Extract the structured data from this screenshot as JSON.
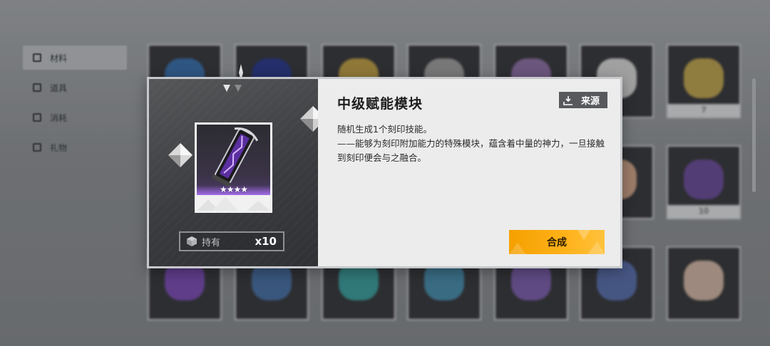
{
  "sidebar": {
    "items": [
      {
        "label": "材料",
        "icon": "material-icon",
        "active": true
      },
      {
        "label": "道具",
        "icon": "prop-icon",
        "active": false
      },
      {
        "label": "消耗",
        "icon": "consumable-icon",
        "active": false
      },
      {
        "label": "礼物",
        "icon": "gift-icon",
        "active": false
      }
    ]
  },
  "grid_counts": [
    "",
    "",
    "",
    "",
    "",
    "",
    "7",
    "",
    "",
    "",
    "",
    "",
    "",
    "10"
  ],
  "modal": {
    "title": "中级赋能模块",
    "source_label": "来源",
    "description": [
      "随机生成1个刻印技能。",
      "——能够为刻印附加能力的特殊模块，蕴含着中量的神力，一旦接触到刻印便会与之融合。"
    ],
    "rarity_stars": "★★★★",
    "holdings_label": "持有",
    "holdings_count": "x10",
    "synthesize_label": "合成",
    "accent_color": "#ffb000"
  }
}
